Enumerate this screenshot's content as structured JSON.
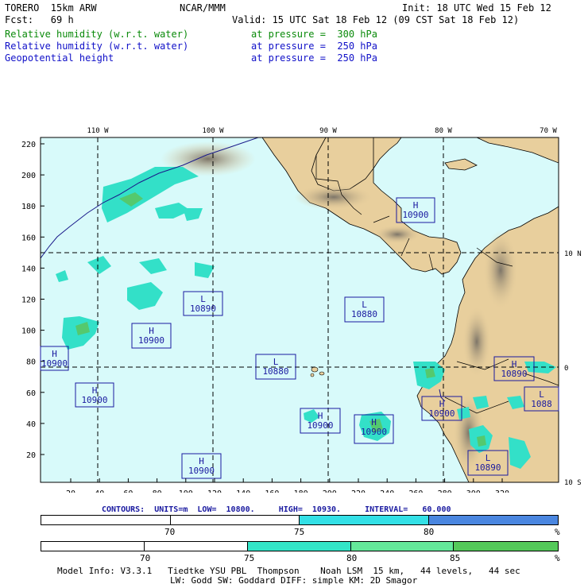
{
  "header": {
    "model": "TORERO  15km ARW",
    "center": "NCAR/MMM",
    "init": "Init: 18 UTC Wed 15 Feb 12",
    "fcst": "Fcst:   69 h",
    "valid": "Valid: 15 UTC Sat 18 Feb 12 (09 CST Sat 18 Feb 12)",
    "fields": [
      {
        "name": "Relative humidity (w.r.t. water)",
        "level": "at pressure =  300 hPa",
        "color": "#0a8a0a"
      },
      {
        "name": "Relative humidity (w.r.t. water)",
        "level": "at pressure =  250 hPa",
        "color": "#1010c8"
      },
      {
        "name": "Geopotential height",
        "level": "at pressure =  250 hPa",
        "color": "#000000"
      }
    ]
  },
  "map": {
    "lon_labels": [
      "110 W",
      "100 W",
      "90 W",
      "80 W",
      "70 W"
    ],
    "lat_labels": [
      "10 N",
      "0",
      "10 S"
    ],
    "y_ticks": [
      "220",
      "200",
      "180",
      "160",
      "140",
      "120",
      "100",
      "80",
      "60",
      "40",
      "20"
    ],
    "x_ticks": [
      "20",
      "40",
      "60",
      "80",
      "100",
      "120",
      "140",
      "160",
      "180",
      "200",
      "220",
      "240",
      "260",
      "280",
      "300",
      "320"
    ],
    "pressure_centers": [
      {
        "type": "H",
        "value": "10900"
      },
      {
        "type": "L",
        "value": "10890"
      },
      {
        "type": "L",
        "value": "10880"
      },
      {
        "type": "H",
        "value": "10900"
      },
      {
        "type": "H",
        "value": "10900"
      },
      {
        "type": "L",
        "value": "10880"
      },
      {
        "type": "H",
        "value": "10900"
      },
      {
        "type": "H",
        "value": "10900"
      },
      {
        "type": "H",
        "value": "10900"
      },
      {
        "type": "H",
        "value": "10900"
      },
      {
        "type": "H",
        "value": "10890"
      },
      {
        "type": "L",
        "value": "1088"
      },
      {
        "type": "L",
        "value": "10890"
      },
      {
        "type": "H",
        "value": "10900"
      }
    ],
    "colors": {
      "ocean": "#d8fafa",
      "land": "#e8cf9d",
      "rh_300": "#33e0c8",
      "rh_300_high": "#54c96e",
      "rh_250": "#4a86e0"
    }
  },
  "contours": {
    "text": "CONTOURS:  UNITS=m  LOW=  10800.     HIGH=  10930.     INTERVAL=   60.000"
  },
  "colorbar1": {
    "labels": [
      "70",
      "75",
      "80",
      "%"
    ],
    "colors": [
      "#ffffff",
      "#ffffff",
      "#33e0e6",
      "#4a86e0"
    ]
  },
  "colorbar2": {
    "labels": [
      "70",
      "75",
      "80",
      "85",
      "%"
    ],
    "colors": [
      "#ffffff",
      "#ffffff",
      "#33e6c8",
      "#64e89a",
      "#54c95a"
    ]
  },
  "footer": {
    "line1": "Model Info: V3.3.1   Tiedtke YSU PBL  Thompson    Noah LSM  15 km,   44 levels,   44 sec",
    "line2": "LW: Godd SW: Goddard DIFF: simple KM: 2D Smagor"
  }
}
